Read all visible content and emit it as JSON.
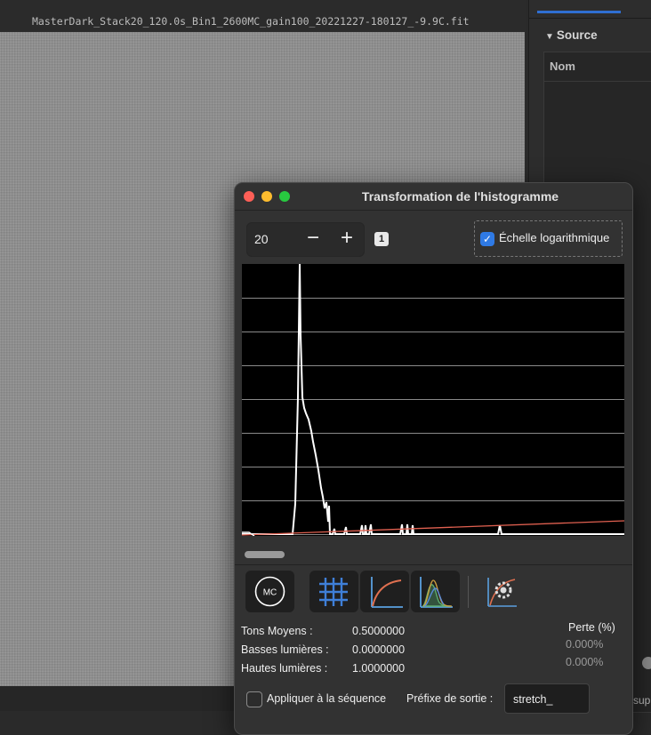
{
  "image_window": {
    "title": "MasterDark_Stack20_120.0s_Bin1_2600MC_gain100_20221227-180127_-9.9C.fit"
  },
  "right_panel": {
    "section_title": "Source",
    "column_name": "Nom",
    "bottom_text": "sup"
  },
  "dialog": {
    "title": "Transformation de l'histogramme",
    "zoom": {
      "value": "20",
      "minus": "−",
      "plus": "+",
      "badge": "1"
    },
    "log_scale": {
      "label": "Échelle logarithmique",
      "checked": true
    },
    "toolbar": {
      "mtf_label": "MC",
      "icons": [
        "mc-circle-icon",
        "grid-icon",
        "curve-icon",
        "rgb-histogram-icon",
        "auto-stretch-icon"
      ]
    },
    "params": {
      "midtones_label": "Tons Moyens :",
      "midtones_value": "0.5000000",
      "shadows_label": "Basses lumières :",
      "shadows_value": "0.0000000",
      "highlights_label": "Hautes lumières :",
      "highlights_value": "1.0000000",
      "loss_header": "Perte (%)",
      "shadows_loss": "0.000%",
      "highlights_loss": "0.000%"
    },
    "apply": {
      "label": "Appliquer à la séquence",
      "checked": false,
      "prefix_label": "Préfixe de sortie :",
      "prefix_value": "stretch_"
    },
    "colors": {
      "histogram_line": "#ffffff",
      "transfer_curve": "#e06050",
      "checkbox_accent": "#2f7ae5"
    }
  }
}
